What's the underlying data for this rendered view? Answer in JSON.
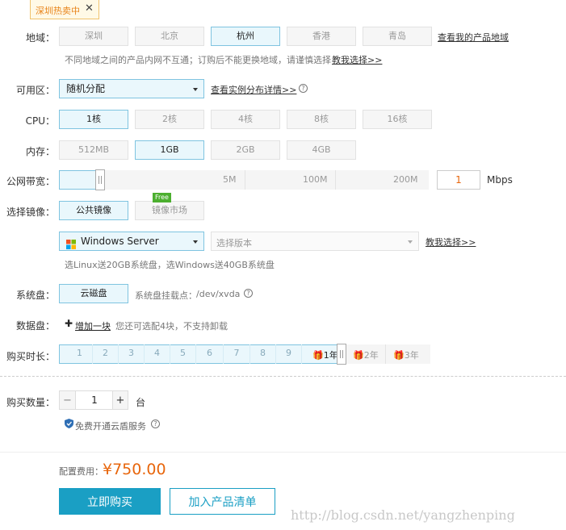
{
  "promo": {
    "tag": "深圳热卖中",
    "close": "✕"
  },
  "region": {
    "label": "地域：",
    "options": [
      "深圳",
      "北京",
      "杭州",
      "香港",
      "青岛"
    ],
    "selected": 2,
    "link": "查看我的产品地域",
    "note": "不同地域之间的产品内网不互通；订购后不能更换地域，请谨慎选择",
    "note_link": "教我选择>>"
  },
  "zone": {
    "label": "可用区：",
    "value": "随机分配",
    "link": "查看实例分布详情>>",
    "help": "?"
  },
  "cpu": {
    "label": "CPU：",
    "options": [
      "1核",
      "2核",
      "4核",
      "8核",
      "16核"
    ],
    "selected": 0
  },
  "memory": {
    "label": "内存：",
    "options": [
      "512MB",
      "1GB",
      "2GB",
      "4GB"
    ],
    "selected": 1
  },
  "bandwidth": {
    "label": "公网带宽：",
    "ticks": [
      "5M",
      "100M",
      "200M"
    ],
    "value": "1",
    "unit": "Mbps"
  },
  "image": {
    "label": "选择镜像：",
    "options": [
      "公共镜像",
      "镜像市场"
    ],
    "selected": 0,
    "badge": "Free",
    "os": "Windows Server",
    "version_placeholder": "选择版本",
    "link": "教我选择>>",
    "note": "选Linux送20GB系统盘，选Windows送40GB系统盘"
  },
  "system_disk": {
    "label": "系统盘：",
    "option": "云磁盘",
    "mount_label": "系统盘挂载点：",
    "mount_point": "/dev/xvda",
    "help": "?"
  },
  "data_disk": {
    "label": "数据盘：",
    "plus": "✚",
    "add": "增加一块",
    "note": "您还可选配4块，不支持卸载"
  },
  "duration": {
    "label": "购买时长：",
    "months": [
      "1",
      "2",
      "3",
      "4",
      "5",
      "6",
      "7",
      "8",
      "9"
    ],
    "years": [
      "1年",
      "2年",
      "3年"
    ],
    "gift": "🎁"
  },
  "quantity": {
    "label": "购买数量：",
    "minus": "−",
    "value": "1",
    "plus": "+",
    "unit": "台"
  },
  "shield": {
    "text": "免费开通云盾服务",
    "help": "?"
  },
  "price": {
    "label": "配置费用：",
    "amount": "¥750.00"
  },
  "actions": {
    "buy": "立即购买",
    "cart": "加入产品清单"
  },
  "watermark": "http://blog.csdn.net/yangzhenping",
  "colors": {
    "accent": "#1a9fc4",
    "price": "#e8660c",
    "selected_bg": "#e9f7fc",
    "selected_border": "#7fc4e0"
  }
}
